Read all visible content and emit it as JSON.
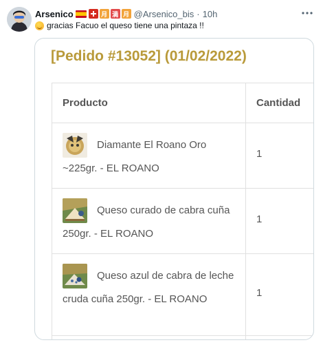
{
  "tweet": {
    "display_name": "Arsenico",
    "handle": "@Arsenico_bis",
    "separator": "·",
    "time": "10h",
    "text": "gracias Facuo el queso tiene una pintaza !!",
    "name_emojis": [
      "spain-flag-icon",
      "swiss-flag-icon",
      "kanji-month-icon",
      "kanji-full-icon",
      "kanji-month-icon"
    ],
    "kanji": [
      "月",
      "満",
      "月"
    ]
  },
  "order": {
    "title": "[Pedido #13052] (01/02/2022)",
    "columns": [
      "Producto",
      "Cantidad"
    ],
    "items": [
      {
        "product": "Diamante El Roano Oro ~225gr. - EL ROANO",
        "quantity": "1",
        "thumb_icon": "cheese-wheel-thumbnail"
      },
      {
        "product": "Queso curado de cabra cuña 250gr. - EL ROANO",
        "quantity": "1",
        "thumb_icon": "cheese-wedge-thumbnail"
      },
      {
        "product": "Queso azul de cabra de leche cruda cuña 250gr. - EL ROANO",
        "quantity": "1",
        "thumb_icon": "blue-cheese-thumbnail"
      }
    ]
  },
  "colors": {
    "title_gold": "#b99a3a",
    "text_dark": "#0f1419",
    "text_muted": "#536471",
    "table_text": "#555555",
    "border": "#e0e0e0"
  }
}
